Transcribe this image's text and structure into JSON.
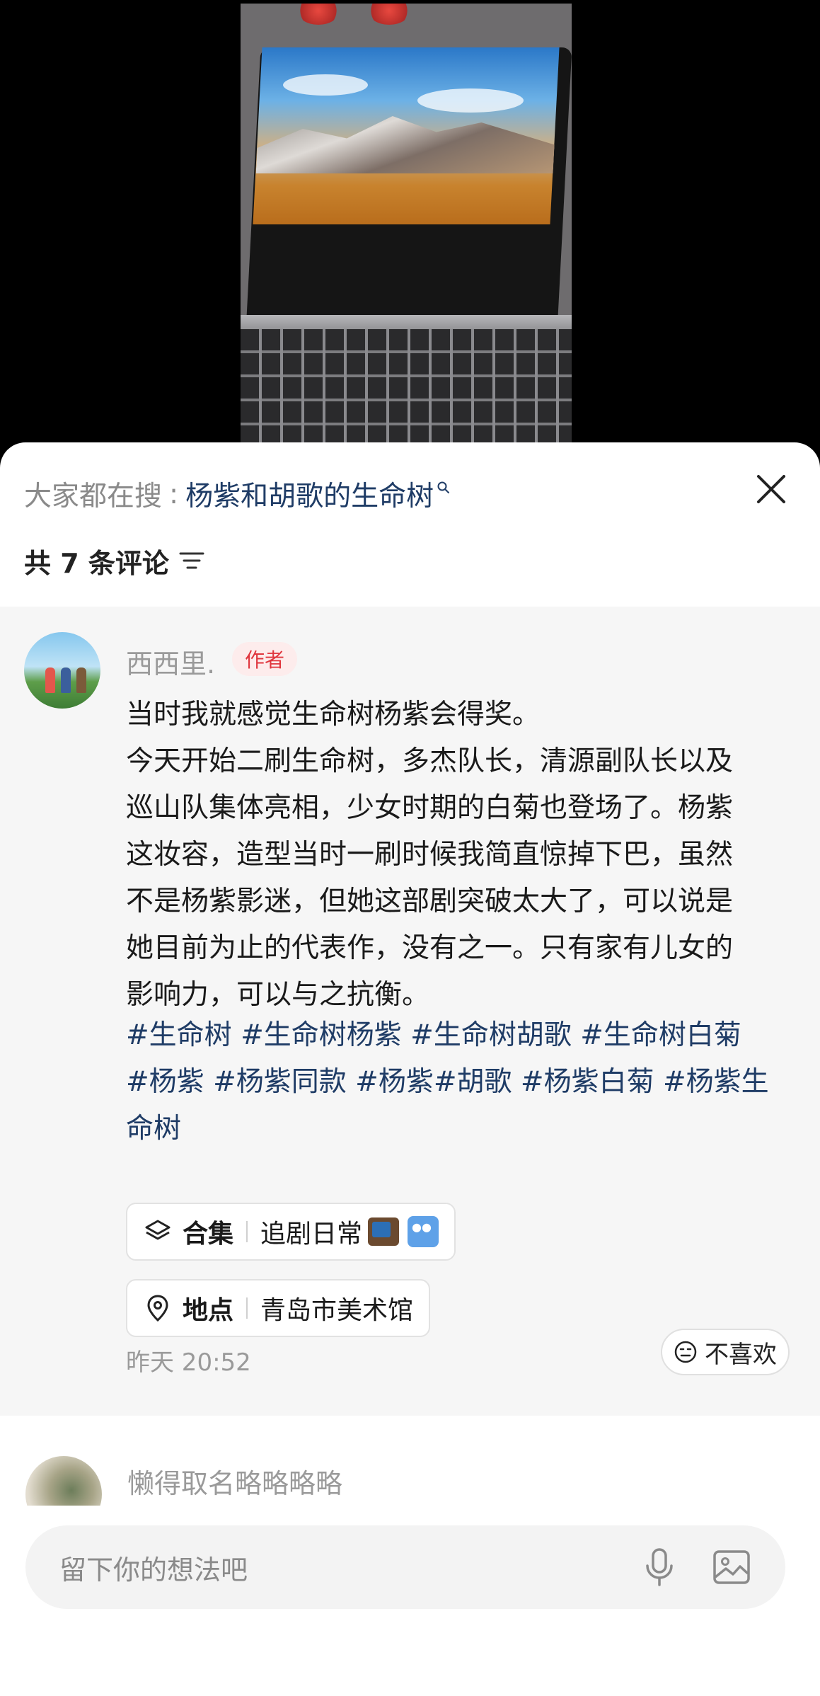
{
  "hot_search": {
    "prefix": "大家都在搜",
    "colon": ":",
    "term": "杨紫和胡歌的生命树"
  },
  "comments_header": {
    "count_label": "共 7 条评论"
  },
  "comment": {
    "author": "西西里.",
    "badge": "作者",
    "lines": [
      "当时我就感觉生命树杨紫会得奖。",
      "今天开始二刷生命树，多杰队长，清源副队长以及",
      "巡山队集体亮相，少女时期的白菊也登场了。杨紫",
      "这妆容，造型当时一刷时候我简直惊掉下巴，虽然",
      "不是杨紫影迷，但她这部剧突破太大了，可以说是",
      "她目前为止的代表作，没有之一。只有家有儿女的",
      "影响力，可以与之抗衡。"
    ],
    "tag_lines": [
      "#生命树 #生命树杨紫 #生命树胡歌 #生命树白菊",
      "#杨紫 #杨紫同款 #杨紫#胡歌 #杨紫白菊 #杨紫生",
      "命树"
    ],
    "collection": {
      "label": "合集",
      "value": "追剧日常",
      "icon": "layers-icon"
    },
    "location": {
      "label": "地点",
      "value": "青岛市美术馆",
      "icon": "location-pin-icon"
    },
    "timestamp": "昨天 20:52",
    "dislike_label": "不喜欢"
  },
  "next_comment": {
    "author": "懒得取名略略略略"
  },
  "input": {
    "placeholder": "留下你的想法吧"
  },
  "colors": {
    "link": "#1f3c66",
    "badge_bg": "#fdecec",
    "badge_text": "#e0363e",
    "comment_bg": "#f6f6f6",
    "input_bg": "#f3f3f3"
  }
}
